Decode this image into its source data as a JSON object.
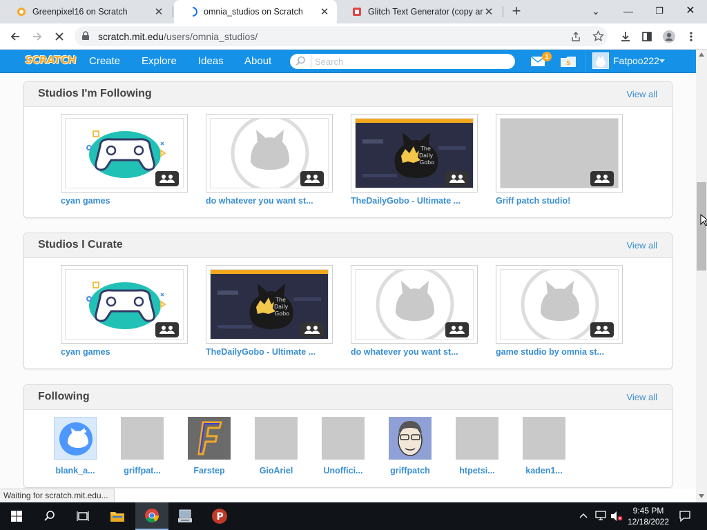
{
  "browser": {
    "tabs": [
      {
        "title": "Greenpixel16 on Scratch",
        "active": false
      },
      {
        "title": "omnia_studios on Scratch",
        "active": true
      },
      {
        "title": "Glitch Text Generator (copy and paste)",
        "active": false
      }
    ],
    "url_domain": "scratch.mit.edu",
    "url_path": "/users/omnia_studios/"
  },
  "nav": {
    "logo": "SCRATCH",
    "links": [
      "Create",
      "Explore",
      "Ideas",
      "About"
    ],
    "search_placeholder": "Search",
    "message_count": "1",
    "username": "Fatpoo222"
  },
  "sections": {
    "following_studios": {
      "title": "Studios I'm Following",
      "view_all": "View all",
      "items": [
        {
          "title": "cyan games",
          "thumb": "controller"
        },
        {
          "title": "do whatever you want st...",
          "thumb": "default-cat"
        },
        {
          "title": "TheDailyGobo - Ultimate ...",
          "thumb": "gobo"
        },
        {
          "title": "Griff patch studio!",
          "thumb": "gray"
        }
      ]
    },
    "curate_studios": {
      "title": "Studios I Curate",
      "view_all": "View all",
      "items": [
        {
          "title": "cyan games",
          "thumb": "controller"
        },
        {
          "title": "TheDailyGobo - Ultimate ...",
          "thumb": "gobo"
        },
        {
          "title": "do whatever you want st...",
          "thumb": "default-cat"
        },
        {
          "title": "game studio by omnia st...",
          "thumb": "default-cat"
        }
      ]
    },
    "following": {
      "title": "Following",
      "view_all": "View all",
      "users": [
        {
          "name": "blank_a...",
          "pic": "blue-cat"
        },
        {
          "name": "griffpat...",
          "pic": "gray"
        },
        {
          "name": "Farstep",
          "pic": "farstep"
        },
        {
          "name": "GioAriel",
          "pic": "gray"
        },
        {
          "name": "Unoffici...",
          "pic": "gray"
        },
        {
          "name": "griffpatch",
          "pic": "face"
        },
        {
          "name": "htpetsi...",
          "pic": "gray"
        },
        {
          "name": "kaden1...",
          "pic": "gray"
        }
      ]
    }
  },
  "status_text": "Waiting for scratch.mit.edu...",
  "clock": {
    "time": "9:45 PM",
    "date": "12/18/2022"
  },
  "colors": {
    "scratch_blue": "#1592e8",
    "link_blue": "#3a8fd2",
    "accent_orange": "#f9a825"
  }
}
